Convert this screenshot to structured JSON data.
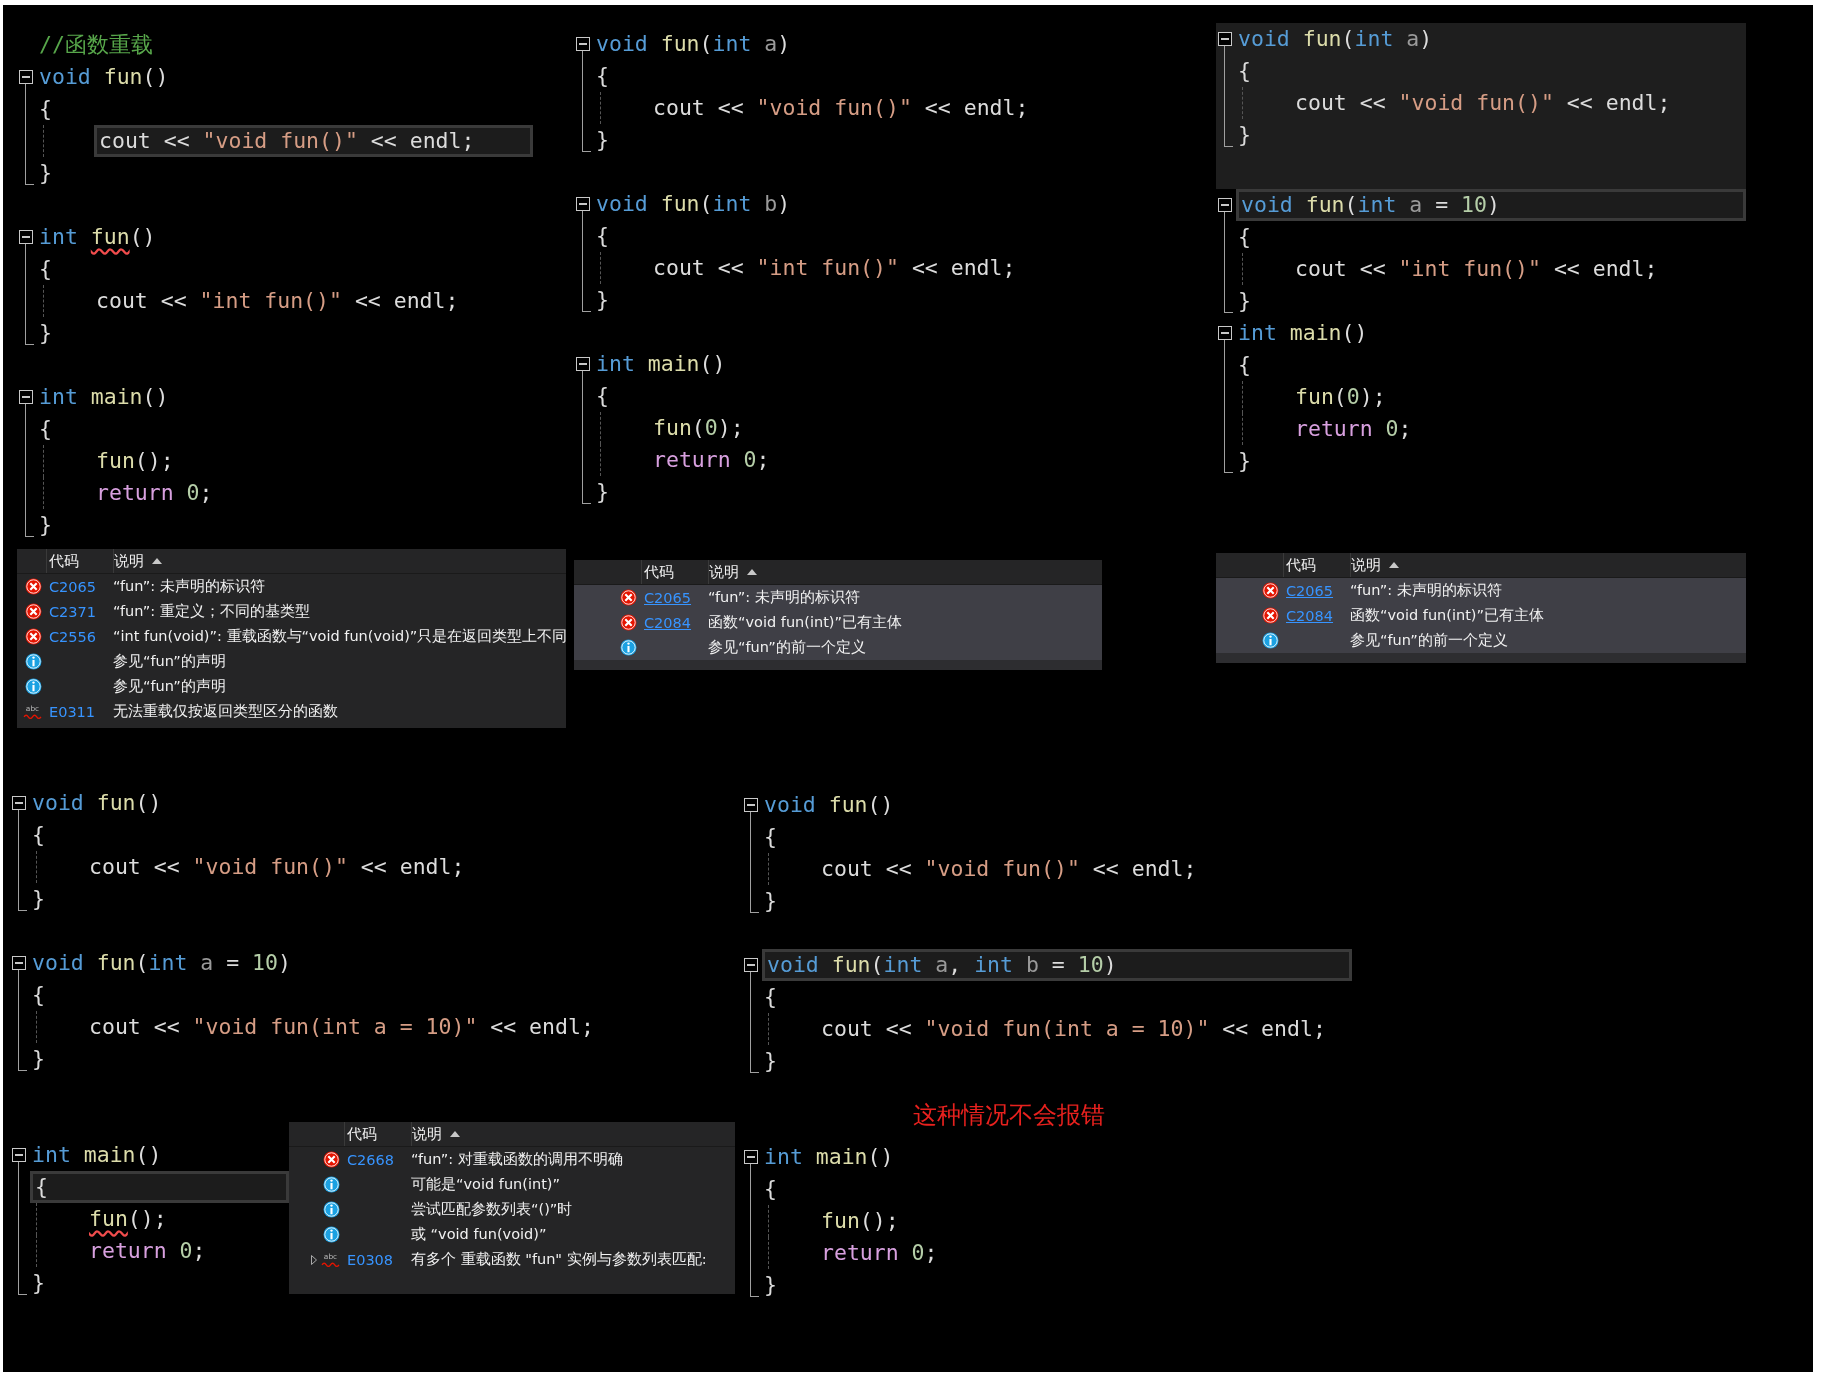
{
  "panels": [
    {
      "functions": [
        {
          "kind": "function",
          "shaded": false,
          "lines": [
            {
              "kind": "comment",
              "highlight": false,
              "tokens": [
                {
                  "text": "//函数重载",
                  "kind": "comment"
                }
              ]
            },
            {
              "kind": "header",
              "highlight": false,
              "tokens": [
                {
                  "text": "void ",
                  "kind": "keyword"
                },
                {
                  "text": "fun",
                  "kind": "function"
                },
                {
                  "text": "()",
                  "kind": "plain"
                }
              ]
            },
            {
              "kind": "brace",
              "highlight": false,
              "tokens": [
                {
                  "text": "{",
                  "kind": "plain"
                }
              ]
            },
            {
              "kind": "body",
              "highlight": true,
              "tokens": [
                {
                  "text": "cout << ",
                  "kind": "plain"
                },
                {
                  "text": "\"void fun()\"",
                  "kind": "string"
                },
                {
                  "text": " << endl;",
                  "kind": "plain"
                }
              ]
            },
            {
              "kind": "brace",
              "highlight": false,
              "tokens": [
                {
                  "text": "}",
                  "kind": "plain"
                }
              ]
            }
          ]
        },
        {
          "kind": "blank"
        },
        {
          "kind": "function",
          "shaded": false,
          "lines": [
            {
              "kind": "header",
              "highlight": false,
              "tokens": [
                {
                  "text": "int ",
                  "kind": "keyword"
                },
                {
                  "text": "fun",
                  "kind": "error"
                },
                {
                  "text": "()",
                  "kind": "plain"
                }
              ]
            },
            {
              "kind": "brace",
              "highlight": false,
              "tokens": [
                {
                  "text": "{",
                  "kind": "plain"
                }
              ]
            },
            {
              "kind": "body",
              "highlight": false,
              "tokens": [
                {
                  "text": "cout << ",
                  "kind": "plain"
                },
                {
                  "text": "\"int fun()\"",
                  "kind": "string"
                },
                {
                  "text": " << endl;",
                  "kind": "plain"
                }
              ]
            },
            {
              "kind": "brace",
              "highlight": false,
              "tokens": [
                {
                  "text": "}",
                  "kind": "plain"
                }
              ]
            }
          ]
        },
        {
          "kind": "blank"
        },
        {
          "kind": "function",
          "shaded": false,
          "lines": [
            {
              "kind": "header",
              "highlight": false,
              "tokens": [
                {
                  "text": "int ",
                  "kind": "keyword"
                },
                {
                  "text": "main",
                  "kind": "function"
                },
                {
                  "text": "()",
                  "kind": "plain"
                }
              ]
            },
            {
              "kind": "brace",
              "highlight": false,
              "tokens": [
                {
                  "text": "{",
                  "kind": "plain"
                }
              ]
            },
            {
              "kind": "body",
              "highlight": false,
              "tokens": [
                {
                  "text": "fun",
                  "kind": "function"
                },
                {
                  "text": "();",
                  "kind": "plain"
                }
              ]
            },
            {
              "kind": "body",
              "highlight": false,
              "tokens": [
                {
                  "text": "return ",
                  "kind": "control"
                },
                {
                  "text": "0",
                  "kind": "number"
                },
                {
                  "text": ";",
                  "kind": "plain"
                }
              ]
            },
            {
              "kind": "brace",
              "highlight": false,
              "tokens": [
                {
                  "text": "}",
                  "kind": "plain"
                }
              ]
            }
          ]
        }
      ],
      "errors": {
        "code_header": "代码",
        "desc_header": "说明",
        "links": false,
        "rows": [
          {
            "kind": "error",
            "selected": false,
            "code": "C2065",
            "text": "“fun”: 未声明的标识符"
          },
          {
            "kind": "error",
            "selected": false,
            "code": "C2371",
            "text": "“fun”: 重定义；不同的基类型"
          },
          {
            "kind": "error",
            "selected": false,
            "code": "C2556",
            "text": "“int fun(void)”: 重载函数与“void fun(void)”只是在返回类型上不同"
          },
          {
            "kind": "info",
            "selected": false,
            "text": "参见“fun”的声明"
          },
          {
            "kind": "info",
            "selected": false,
            "text": "参见“fun”的声明"
          },
          {
            "kind": "spelling",
            "icon_label": "abc",
            "selected": false,
            "code": "E0311",
            "text": "无法重载仅按返回类型区分的函数"
          }
        ]
      }
    },
    {
      "functions": [
        {
          "kind": "function",
          "shaded": false,
          "lines": [
            {
              "kind": "header",
              "highlight": false,
              "tokens": [
                {
                  "text": "void ",
                  "kind": "keyword"
                },
                {
                  "text": "fun",
                  "kind": "function"
                },
                {
                  "text": "(",
                  "kind": "plain"
                },
                {
                  "text": "int ",
                  "kind": "keyword"
                },
                {
                  "text": "a",
                  "kind": "param"
                },
                {
                  "text": ")",
                  "kind": "plain"
                }
              ]
            },
            {
              "kind": "brace",
              "highlight": false,
              "tokens": [
                {
                  "text": "{",
                  "kind": "plain"
                }
              ]
            },
            {
              "kind": "body",
              "highlight": false,
              "tokens": [
                {
                  "text": "cout << ",
                  "kind": "plain"
                },
                {
                  "text": "\"void fun()\"",
                  "kind": "string"
                },
                {
                  "text": " << endl;",
                  "kind": "plain"
                }
              ]
            },
            {
              "kind": "brace",
              "highlight": false,
              "tokens": [
                {
                  "text": "}",
                  "kind": "plain"
                }
              ]
            }
          ]
        },
        {
          "kind": "blank"
        },
        {
          "kind": "function",
          "shaded": false,
          "lines": [
            {
              "kind": "header",
              "highlight": false,
              "tokens": [
                {
                  "text": "void ",
                  "kind": "keyword"
                },
                {
                  "text": "fun",
                  "kind": "function"
                },
                {
                  "text": "(",
                  "kind": "plain"
                },
                {
                  "text": "int ",
                  "kind": "keyword"
                },
                {
                  "text": "b",
                  "kind": "param"
                },
                {
                  "text": ")",
                  "kind": "plain"
                }
              ]
            },
            {
              "kind": "brace",
              "highlight": false,
              "tokens": [
                {
                  "text": "{",
                  "kind": "plain"
                }
              ]
            },
            {
              "kind": "body",
              "highlight": false,
              "tokens": [
                {
                  "text": "cout << ",
                  "kind": "plain"
                },
                {
                  "text": "\"int fun()\"",
                  "kind": "string"
                },
                {
                  "text": " << endl;",
                  "kind": "plain"
                }
              ]
            },
            {
              "kind": "brace",
              "highlight": false,
              "tokens": [
                {
                  "text": "}",
                  "kind": "plain"
                }
              ]
            }
          ]
        },
        {
          "kind": "blank"
        },
        {
          "kind": "function",
          "shaded": false,
          "lines": [
            {
              "kind": "header",
              "highlight": false,
              "tokens": [
                {
                  "text": "int ",
                  "kind": "keyword"
                },
                {
                  "text": "main",
                  "kind": "function"
                },
                {
                  "text": "()",
                  "kind": "plain"
                }
              ]
            },
            {
              "kind": "brace",
              "highlight": false,
              "tokens": [
                {
                  "text": "{",
                  "kind": "plain"
                }
              ]
            },
            {
              "kind": "body",
              "highlight": false,
              "tokens": [
                {
                  "text": "fun",
                  "kind": "function"
                },
                {
                  "text": "(",
                  "kind": "plain"
                },
                {
                  "text": "0",
                  "kind": "number"
                },
                {
                  "text": ");",
                  "kind": "plain"
                }
              ]
            },
            {
              "kind": "body",
              "highlight": false,
              "tokens": [
                {
                  "text": "return ",
                  "kind": "control"
                },
                {
                  "text": "0",
                  "kind": "number"
                },
                {
                  "text": ";",
                  "kind": "plain"
                }
              ]
            },
            {
              "kind": "brace",
              "highlight": false,
              "tokens": [
                {
                  "text": "}",
                  "kind": "plain"
                }
              ]
            }
          ]
        }
      ],
      "errors": {
        "code_header": "代码",
        "desc_header": "说明",
        "links": true,
        "rows": [
          {
            "kind": "error",
            "selected": true,
            "code": "C2065",
            "text": "“fun”: 未声明的标识符"
          },
          {
            "kind": "error",
            "selected": true,
            "code": "C2084",
            "text": "函数“void fun(int)”已有主体"
          },
          {
            "kind": "info",
            "selected": true,
            "text": "参见“fun”的前一个定义"
          }
        ]
      }
    },
    {
      "functions": [
        {
          "kind": "function",
          "shaded": true,
          "lines": [
            {
              "kind": "header",
              "highlight": false,
              "tokens": [
                {
                  "text": "void ",
                  "kind": "keyword"
                },
                {
                  "text": "fun",
                  "kind": "function"
                },
                {
                  "text": "(",
                  "kind": "plain"
                },
                {
                  "text": "int ",
                  "kind": "keyword"
                },
                {
                  "text": "a",
                  "kind": "param"
                },
                {
                  "text": ")",
                  "kind": "plain"
                }
              ]
            },
            {
              "kind": "brace",
              "highlight": false,
              "tokens": [
                {
                  "text": "{",
                  "kind": "plain"
                }
              ]
            },
            {
              "kind": "body",
              "highlight": false,
              "tokens": [
                {
                  "text": "cout << ",
                  "kind": "plain"
                },
                {
                  "text": "\"void fun()\"",
                  "kind": "string"
                },
                {
                  "text": " << endl;",
                  "kind": "plain"
                }
              ]
            },
            {
              "kind": "brace",
              "highlight": false,
              "tokens": [
                {
                  "text": "}",
                  "kind": "plain"
                }
              ]
            }
          ]
        },
        {
          "kind": "blank",
          "shaded": true
        },
        {
          "kind": "function",
          "shaded": false,
          "lines": [
            {
              "kind": "header",
              "highlight": true,
              "tokens": [
                {
                  "text": "void ",
                  "kind": "keyword"
                },
                {
                  "text": "fun",
                  "kind": "function"
                },
                {
                  "text": "(",
                  "kind": "plain"
                },
                {
                  "text": "int ",
                  "kind": "keyword"
                },
                {
                  "text": "a",
                  "kind": "param"
                },
                {
                  "text": " = ",
                  "kind": "plain"
                },
                {
                  "text": "10",
                  "kind": "number"
                },
                {
                  "text": ")",
                  "kind": "plain"
                }
              ]
            },
            {
              "kind": "brace",
              "highlight": false,
              "tokens": [
                {
                  "text": "{",
                  "kind": "plain"
                }
              ]
            },
            {
              "kind": "body",
              "highlight": false,
              "tokens": [
                {
                  "text": "cout << ",
                  "kind": "plain"
                },
                {
                  "text": "\"int fun()\"",
                  "kind": "string"
                },
                {
                  "text": " << endl;",
                  "kind": "plain"
                }
              ]
            },
            {
              "kind": "brace",
              "highlight": false,
              "tokens": [
                {
                  "text": "}",
                  "kind": "plain"
                }
              ]
            }
          ]
        },
        {
          "kind": "function",
          "shaded": false,
          "lines": [
            {
              "kind": "header",
              "highlight": false,
              "tokens": [
                {
                  "text": "int ",
                  "kind": "keyword"
                },
                {
                  "text": "main",
                  "kind": "function"
                },
                {
                  "text": "()",
                  "kind": "plain"
                }
              ]
            },
            {
              "kind": "brace",
              "highlight": false,
              "tokens": [
                {
                  "text": "{",
                  "kind": "plain"
                }
              ]
            },
            {
              "kind": "body",
              "highlight": false,
              "tokens": [
                {
                  "text": "fun",
                  "kind": "function"
                },
                {
                  "text": "(",
                  "kind": "plain"
                },
                {
                  "text": "0",
                  "kind": "number"
                },
                {
                  "text": ");",
                  "kind": "plain"
                }
              ]
            },
            {
              "kind": "body",
              "highlight": false,
              "tokens": [
                {
                  "text": "return ",
                  "kind": "control"
                },
                {
                  "text": "0",
                  "kind": "number"
                },
                {
                  "text": ";",
                  "kind": "plain"
                }
              ]
            },
            {
              "kind": "brace",
              "highlight": false,
              "tokens": [
                {
                  "text": "}",
                  "kind": "plain"
                }
              ]
            }
          ]
        }
      ],
      "errors": {
        "code_header": "代码",
        "desc_header": "说明",
        "links": true,
        "rows": [
          {
            "kind": "error",
            "selected": true,
            "code": "C2065",
            "text": "“fun”: 未声明的标识符"
          },
          {
            "kind": "error",
            "selected": true,
            "code": "C2084",
            "text": "函数“void fun(int)”已有主体"
          },
          {
            "kind": "info",
            "selected": true,
            "text": "参见“fun”的前一个定义"
          }
        ]
      }
    },
    {
      "functions": [
        {
          "kind": "function",
          "shaded": false,
          "lines": [
            {
              "kind": "header",
              "highlight": false,
              "tokens": [
                {
                  "text": "void ",
                  "kind": "keyword"
                },
                {
                  "text": "fun",
                  "kind": "function"
                },
                {
                  "text": "()",
                  "kind": "plain"
                }
              ]
            },
            {
              "kind": "brace",
              "highlight": false,
              "tokens": [
                {
                  "text": "{",
                  "kind": "plain"
                }
              ]
            },
            {
              "kind": "body",
              "highlight": false,
              "tokens": [
                {
                  "text": "cout << ",
                  "kind": "plain"
                },
                {
                  "text": "\"void fun()\"",
                  "kind": "string"
                },
                {
                  "text": " << endl;",
                  "kind": "plain"
                }
              ]
            },
            {
              "kind": "brace",
              "highlight": false,
              "tokens": [
                {
                  "text": "}",
                  "kind": "plain"
                }
              ]
            }
          ]
        },
        {
          "kind": "blank"
        },
        {
          "kind": "function",
          "shaded": false,
          "lines": [
            {
              "kind": "header",
              "highlight": false,
              "tokens": [
                {
                  "text": "void ",
                  "kind": "keyword"
                },
                {
                  "text": "fun",
                  "kind": "function"
                },
                {
                  "text": "(",
                  "kind": "plain"
                },
                {
                  "text": "int ",
                  "kind": "keyword"
                },
                {
                  "text": "a",
                  "kind": "param"
                },
                {
                  "text": " = ",
                  "kind": "plain"
                },
                {
                  "text": "10",
                  "kind": "number"
                },
                {
                  "text": ")",
                  "kind": "plain"
                }
              ]
            },
            {
              "kind": "brace",
              "highlight": false,
              "tokens": [
                {
                  "text": "{",
                  "kind": "plain"
                }
              ]
            },
            {
              "kind": "body",
              "highlight": false,
              "tokens": [
                {
                  "text": "cout << ",
                  "kind": "plain"
                },
                {
                  "text": "\"void fun(int a = 10)\"",
                  "kind": "string"
                },
                {
                  "text": " << endl;",
                  "kind": "plain"
                }
              ]
            },
            {
              "kind": "brace",
              "highlight": false,
              "tokens": [
                {
                  "text": "}",
                  "kind": "plain"
                }
              ]
            }
          ]
        },
        {
          "kind": "blank"
        },
        {
          "kind": "blank"
        },
        {
          "kind": "function",
          "shaded": false,
          "lines": [
            {
              "kind": "header",
              "highlight": false,
              "tokens": [
                {
                  "text": "int ",
                  "kind": "keyword"
                },
                {
                  "text": "main",
                  "kind": "function"
                },
                {
                  "text": "()",
                  "kind": "plain"
                }
              ]
            },
            {
              "kind": "brace",
              "highlight": true,
              "tokens": [
                {
                  "text": "{",
                  "kind": "plain"
                }
              ]
            },
            {
              "kind": "body",
              "highlight": false,
              "tokens": [
                {
                  "text": "fun",
                  "kind": "error"
                },
                {
                  "text": "();",
                  "kind": "plain"
                }
              ]
            },
            {
              "kind": "body",
              "highlight": false,
              "tokens": [
                {
                  "text": "return ",
                  "kind": "control"
                },
                {
                  "text": "0",
                  "kind": "number"
                },
                {
                  "text": ";",
                  "kind": "plain"
                }
              ]
            },
            {
              "kind": "brace",
              "highlight": false,
              "tokens": [
                {
                  "text": "}",
                  "kind": "plain"
                }
              ]
            }
          ]
        }
      ],
      "errors": {
        "code_header": "代码",
        "desc_header": "说明",
        "links": false,
        "rows": [
          {
            "kind": "error",
            "selected": false,
            "expandable": false,
            "code": "C2668",
            "text": "“fun”: 对重载函数的调用不明确"
          },
          {
            "kind": "info",
            "selected": false,
            "expandable": false,
            "text": "可能是“void fun(int)”"
          },
          {
            "kind": "info",
            "selected": false,
            "expandable": false,
            "text": "尝试匹配参数列表“()”时"
          },
          {
            "kind": "info",
            "selected": false,
            "expandable": false,
            "text": "或    “void fun(void)”"
          },
          {
            "kind": "spelling",
            "icon_label": "abc",
            "selected": false,
            "expandable": true,
            "code": "E0308",
            "text": "有多个 重载函数 \"fun\" 实例与参数列表匹配:"
          }
        ]
      }
    },
    {
      "functions": [
        {
          "kind": "function",
          "shaded": false,
          "lines": [
            {
              "kind": "header",
              "highlight": false,
              "tokens": [
                {
                  "text": "void ",
                  "kind": "keyword"
                },
                {
                  "text": "fun",
                  "kind": "function"
                },
                {
                  "text": "()",
                  "kind": "plain"
                }
              ]
            },
            {
              "kind": "brace",
              "highlight": false,
              "tokens": [
                {
                  "text": "{",
                  "kind": "plain"
                }
              ]
            },
            {
              "kind": "body",
              "highlight": false,
              "tokens": [
                {
                  "text": "cout << ",
                  "kind": "plain"
                },
                {
                  "text": "\"void fun()\"",
                  "kind": "string"
                },
                {
                  "text": " << endl;",
                  "kind": "plain"
                }
              ]
            },
            {
              "kind": "brace",
              "highlight": false,
              "tokens": [
                {
                  "text": "}",
                  "kind": "plain"
                }
              ]
            }
          ]
        },
        {
          "kind": "blank"
        },
        {
          "kind": "function",
          "shaded": false,
          "lines": [
            {
              "kind": "header",
              "highlight": true,
              "tokens": [
                {
                  "text": "void ",
                  "kind": "keyword"
                },
                {
                  "text": "fun",
                  "kind": "function"
                },
                {
                  "text": "(",
                  "kind": "plain"
                },
                {
                  "text": "int ",
                  "kind": "keyword"
                },
                {
                  "text": "a",
                  "kind": "param"
                },
                {
                  "text": ", ",
                  "kind": "plain"
                },
                {
                  "text": "int ",
                  "kind": "keyword"
                },
                {
                  "text": "b",
                  "kind": "param"
                },
                {
                  "text": " = ",
                  "kind": "plain"
                },
                {
                  "text": "10",
                  "kind": "number"
                },
                {
                  "text": ")",
                  "kind": "plain"
                }
              ]
            },
            {
              "kind": "brace",
              "highlight": false,
              "tokens": [
                {
                  "text": "{",
                  "kind": "plain"
                }
              ]
            },
            {
              "kind": "body",
              "highlight": false,
              "tokens": [
                {
                  "text": "cout << ",
                  "kind": "plain"
                },
                {
                  "text": "\"void fun(int a = 10)\"",
                  "kind": "string"
                },
                {
                  "text": " << endl;",
                  "kind": "plain"
                }
              ]
            },
            {
              "kind": "brace",
              "highlight": false,
              "tokens": [
                {
                  "text": "}",
                  "kind": "plain"
                }
              ]
            }
          ]
        },
        {
          "kind": "blank"
        },
        {
          "kind": "blank"
        },
        {
          "kind": "function",
          "shaded": false,
          "lines": [
            {
              "kind": "header",
              "highlight": false,
              "tokens": [
                {
                  "text": "int ",
                  "kind": "keyword"
                },
                {
                  "text": "main",
                  "kind": "function"
                },
                {
                  "text": "()",
                  "kind": "plain"
                }
              ]
            },
            {
              "kind": "brace",
              "highlight": false,
              "tokens": [
                {
                  "text": "{",
                  "kind": "plain"
                }
              ]
            },
            {
              "kind": "body",
              "highlight": false,
              "tokens": [
                {
                  "text": "fun",
                  "kind": "function"
                },
                {
                  "text": "();",
                  "kind": "plain"
                }
              ]
            },
            {
              "kind": "body",
              "highlight": false,
              "tokens": [
                {
                  "text": "return ",
                  "kind": "control"
                },
                {
                  "text": "0",
                  "kind": "number"
                },
                {
                  "text": ";",
                  "kind": "plain"
                }
              ]
            },
            {
              "kind": "brace",
              "highlight": false,
              "tokens": [
                {
                  "text": "}",
                  "kind": "plain"
                }
              ]
            }
          ]
        }
      ],
      "note": "这种情况不会报错"
    }
  ]
}
